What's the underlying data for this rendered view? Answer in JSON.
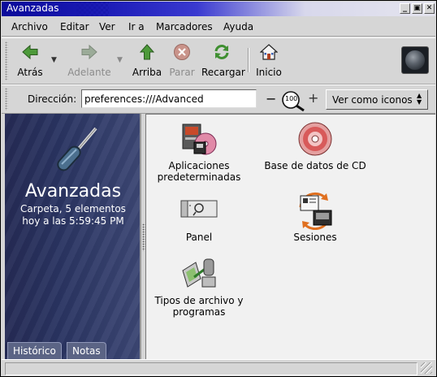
{
  "window": {
    "title": "Avanzadas",
    "controls": {
      "minimize": "_",
      "maximize": "▣",
      "close": "✕"
    }
  },
  "menubar": {
    "items": [
      {
        "label": "Archivo",
        "icon": ""
      },
      {
        "label": "Editar"
      },
      {
        "label": "Ver"
      },
      {
        "label": "Ir a"
      },
      {
        "label": "Marcadores"
      },
      {
        "label": "Ayuda"
      }
    ]
  },
  "toolbar": {
    "back_label": "Atrás",
    "forward_label": "Adelante",
    "up_label": "Arriba",
    "stop_label": "Parar",
    "reload_label": "Recargar",
    "home_label": "Inicio"
  },
  "location": {
    "label": "Dirección:",
    "value": "preferences:///Advanced",
    "zoom_value": "100",
    "view_as": "Ver como iconos"
  },
  "sidebar": {
    "title": "Avanzadas",
    "info_line1": "Carpeta, 5 elementos",
    "info_line2": "hoy a las 5:59:45 PM",
    "tabs": [
      "Histórico",
      "Notas"
    ]
  },
  "icons": [
    {
      "label_line1": "Aplicaciones",
      "label_line2": "predeterminadas",
      "icon": "default-applications-icon"
    },
    {
      "label_line1": "Base de datos de CD",
      "label_line2": "",
      "icon": "cd-database-icon"
    },
    {
      "label_line1": "Panel",
      "label_line2": "",
      "icon": "panel-icon"
    },
    {
      "label_line1": "Sesiones",
      "label_line2": "",
      "icon": "sessions-icon"
    },
    {
      "label_line1": "Tipos de archivo y",
      "label_line2": "programas",
      "icon": "file-types-icon"
    }
  ],
  "colors": {
    "sidebar": "#2a3462",
    "titlebar": "#1d1db8",
    "iconview": "#f1f1f1"
  }
}
